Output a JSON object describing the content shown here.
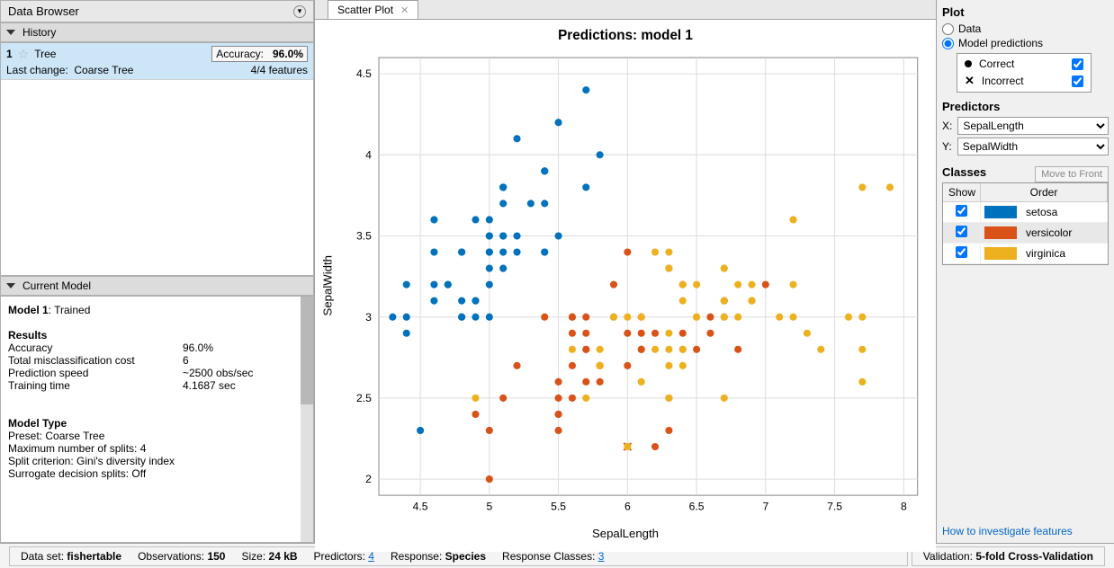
{
  "left": {
    "panel_title": "Data Browser",
    "history_header": "History",
    "history_item": {
      "index": "1",
      "name": "Tree",
      "accuracy_label": "Accuracy:",
      "accuracy_value": "96.0%",
      "last_change_label": "Last change:",
      "last_change_value": "Coarse Tree",
      "features": "4/4 features"
    },
    "current_header": "Current Model",
    "model_title_bold": "Model 1",
    "model_title_suffix": ": Trained",
    "results_header": "Results",
    "results": {
      "accuracy_label": "Accuracy",
      "accuracy_value": "96.0%",
      "cost_label": "Total misclassification cost",
      "cost_value": "6",
      "speed_label": "Prediction speed",
      "speed_value": "~2500 obs/sec",
      "time_label": "Training time",
      "time_value": "4.1687 sec"
    },
    "modeltype_header": "Model Type",
    "modeltype": {
      "preset": "Preset: Coarse Tree",
      "splits": "Maximum number of splits: 4",
      "criterion": "Split criterion: Gini's diversity index",
      "surrogate": "Surrogate decision splits: Off"
    }
  },
  "tab_label": "Scatter Plot",
  "right_panel": {
    "plot_header": "Plot",
    "radio_data": "Data",
    "radio_modelpred": "Model predictions",
    "legend_correct": "Correct",
    "legend_incorrect": "Incorrect",
    "predictors_header": "Predictors",
    "x_label": "X:",
    "y_label": "Y:",
    "x_value": "SepalLength",
    "y_value": "SepalWidth",
    "classes_header": "Classes",
    "move_to_front": "Move to Front",
    "col_show": "Show",
    "col_order": "Order",
    "classes": [
      {
        "name": "setosa",
        "color": "#0072bd"
      },
      {
        "name": "versicolor",
        "color": "#d95319"
      },
      {
        "name": "virginica",
        "color": "#edb120"
      }
    ],
    "help_link": "How to investigate features"
  },
  "status": {
    "dataset_label": "Data set:",
    "dataset_value": "fishertable",
    "obs_label": "Observations:",
    "obs_value": "150",
    "size_label": "Size:",
    "size_value": "24 kB",
    "pred_label": "Predictors:",
    "pred_value": "4",
    "resp_label": "Response:",
    "resp_value": "Species",
    "rc_label": "Response Classes:",
    "rc_value": "3",
    "validation_label": "Validation:",
    "validation_value": "5-fold Cross-Validation"
  },
  "chart_data": {
    "type": "scatter",
    "title": "Predictions: model 1",
    "xlabel": "SepalLength",
    "ylabel": "SepalWidth",
    "xlim": [
      4.2,
      8.1
    ],
    "ylim": [
      1.9,
      4.6
    ],
    "xticks": [
      4.5,
      5,
      5.5,
      6,
      6.5,
      7,
      7.5,
      8
    ],
    "yticks": [
      2,
      2.5,
      3,
      3.5,
      4,
      4.5
    ],
    "series": [
      {
        "name": "setosa",
        "color": "#0072bd",
        "points": [
          [
            5.1,
            3.5
          ],
          [
            4.9,
            3.0
          ],
          [
            4.7,
            3.2
          ],
          [
            4.6,
            3.1
          ],
          [
            5.0,
            3.6
          ],
          [
            5.4,
            3.9
          ],
          [
            4.6,
            3.4
          ],
          [
            5.0,
            3.4
          ],
          [
            4.4,
            2.9
          ],
          [
            4.9,
            3.1
          ],
          [
            5.4,
            3.7
          ],
          [
            4.8,
            3.4
          ],
          [
            4.8,
            3.0
          ],
          [
            4.3,
            3.0
          ],
          [
            5.8,
            4.0
          ],
          [
            5.7,
            4.4
          ],
          [
            5.4,
            3.9
          ],
          [
            5.1,
            3.5
          ],
          [
            5.7,
            3.8
          ],
          [
            5.1,
            3.8
          ],
          [
            5.4,
            3.4
          ],
          [
            5.1,
            3.7
          ],
          [
            4.6,
            3.6
          ],
          [
            5.1,
            3.3
          ],
          [
            4.8,
            3.4
          ],
          [
            5.0,
            3.0
          ],
          [
            5.0,
            3.4
          ],
          [
            5.2,
            3.5
          ],
          [
            5.2,
            3.4
          ],
          [
            4.7,
            3.2
          ],
          [
            4.8,
            3.1
          ],
          [
            5.4,
            3.4
          ],
          [
            5.2,
            4.1
          ],
          [
            5.5,
            4.2
          ],
          [
            4.9,
            3.1
          ],
          [
            5.0,
            3.2
          ],
          [
            5.5,
            3.5
          ],
          [
            4.9,
            3.6
          ],
          [
            4.4,
            3.0
          ],
          [
            5.1,
            3.4
          ],
          [
            5.0,
            3.5
          ],
          [
            4.5,
            2.3
          ],
          [
            4.4,
            3.2
          ],
          [
            5.0,
            3.5
          ],
          [
            5.1,
            3.8
          ],
          [
            4.8,
            3.0
          ],
          [
            5.1,
            3.8
          ],
          [
            4.6,
            3.2
          ],
          [
            5.3,
            3.7
          ],
          [
            5.0,
            3.3
          ]
        ],
        "incorrect": []
      },
      {
        "name": "versicolor",
        "color": "#d95319",
        "points": [
          [
            7.0,
            3.2
          ],
          [
            6.4,
            3.2
          ],
          [
            6.9,
            3.1
          ],
          [
            5.5,
            2.3
          ],
          [
            6.5,
            2.8
          ],
          [
            5.7,
            2.8
          ],
          [
            6.3,
            3.3
          ],
          [
            4.9,
            2.4
          ],
          [
            6.6,
            2.9
          ],
          [
            5.2,
            2.7
          ],
          [
            5.0,
            2.0
          ],
          [
            5.9,
            3.0
          ],
          [
            6.0,
            2.2
          ],
          [
            6.1,
            2.9
          ],
          [
            5.6,
            2.9
          ],
          [
            6.7,
            3.1
          ],
          [
            5.6,
            3.0
          ],
          [
            5.8,
            2.7
          ],
          [
            6.2,
            2.2
          ],
          [
            5.6,
            2.5
          ],
          [
            5.9,
            3.2
          ],
          [
            6.1,
            2.8
          ],
          [
            6.3,
            2.5
          ],
          [
            6.1,
            2.8
          ],
          [
            6.4,
            2.9
          ],
          [
            6.6,
            3.0
          ],
          [
            6.8,
            2.8
          ],
          [
            6.7,
            3.0
          ],
          [
            6.0,
            2.9
          ],
          [
            5.7,
            2.6
          ],
          [
            5.5,
            2.4
          ],
          [
            5.5,
            2.4
          ],
          [
            5.8,
            2.7
          ],
          [
            6.0,
            2.7
          ],
          [
            5.4,
            3.0
          ],
          [
            6.0,
            3.4
          ],
          [
            6.7,
            3.1
          ],
          [
            6.3,
            2.3
          ],
          [
            5.6,
            3.0
          ],
          [
            5.5,
            2.5
          ],
          [
            5.5,
            2.6
          ],
          [
            6.1,
            3.0
          ],
          [
            5.8,
            2.6
          ],
          [
            5.0,
            2.3
          ],
          [
            5.6,
            2.7
          ],
          [
            5.7,
            3.0
          ],
          [
            5.7,
            2.9
          ],
          [
            6.2,
            2.9
          ],
          [
            5.1,
            2.5
          ],
          [
            5.7,
            2.8
          ]
        ],
        "incorrect": [
          [
            6.1,
            2.2
          ],
          [
            5.0,
            2.5
          ],
          [
            6.0,
            2.2
          ]
        ]
      },
      {
        "name": "virginica",
        "color": "#edb120",
        "points": [
          [
            6.3,
            3.3
          ],
          [
            5.8,
            2.7
          ],
          [
            7.1,
            3.0
          ],
          [
            6.3,
            2.9
          ],
          [
            6.5,
            3.0
          ],
          [
            7.6,
            3.0
          ],
          [
            4.9,
            2.5
          ],
          [
            7.3,
            2.9
          ],
          [
            6.7,
            2.5
          ],
          [
            7.2,
            3.6
          ],
          [
            6.5,
            3.2
          ],
          [
            6.4,
            2.7
          ],
          [
            6.8,
            3.0
          ],
          [
            5.7,
            2.5
          ],
          [
            5.8,
            2.8
          ],
          [
            6.4,
            3.2
          ],
          [
            6.5,
            3.0
          ],
          [
            7.7,
            3.8
          ],
          [
            7.7,
            2.6
          ],
          [
            6.0,
            2.2
          ],
          [
            6.9,
            3.2
          ],
          [
            5.6,
            2.8
          ],
          [
            7.7,
            2.8
          ],
          [
            6.3,
            2.7
          ],
          [
            6.7,
            3.3
          ],
          [
            7.2,
            3.2
          ],
          [
            6.2,
            2.8
          ],
          [
            6.1,
            3.0
          ],
          [
            6.4,
            2.8
          ],
          [
            7.2,
            3.0
          ],
          [
            7.4,
            2.8
          ],
          [
            7.9,
            3.8
          ],
          [
            6.4,
            2.8
          ],
          [
            6.3,
            2.8
          ],
          [
            6.1,
            2.6
          ],
          [
            7.7,
            3.0
          ],
          [
            6.3,
            3.4
          ],
          [
            6.4,
            3.1
          ],
          [
            6.0,
            3.0
          ],
          [
            6.9,
            3.1
          ],
          [
            6.7,
            3.1
          ],
          [
            6.9,
            3.1
          ],
          [
            5.8,
            2.7
          ],
          [
            6.8,
            3.2
          ],
          [
            6.7,
            3.3
          ],
          [
            6.7,
            3.0
          ],
          [
            6.3,
            2.5
          ],
          [
            6.5,
            3.0
          ],
          [
            6.2,
            3.4
          ],
          [
            5.9,
            3.0
          ]
        ],
        "incorrect": [
          [
            5.7,
            3.2
          ],
          [
            6.4,
            2.5
          ],
          [
            6.0,
            2.7
          ]
        ]
      }
    ]
  }
}
